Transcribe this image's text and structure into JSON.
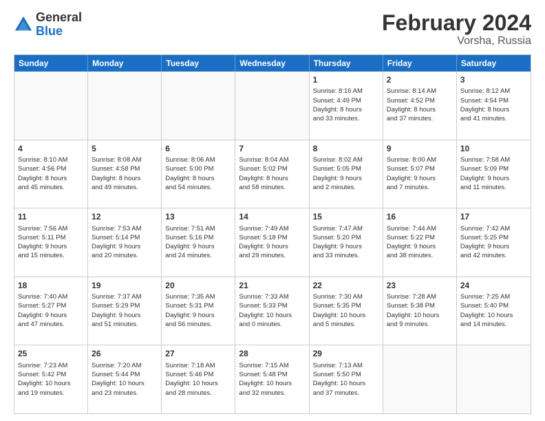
{
  "header": {
    "logo_general": "General",
    "logo_blue": "Blue",
    "month_title": "February 2024",
    "location": "Vorsha, Russia"
  },
  "days_of_week": [
    "Sunday",
    "Monday",
    "Tuesday",
    "Wednesday",
    "Thursday",
    "Friday",
    "Saturday"
  ],
  "rows": [
    [
      {
        "day": "",
        "info": ""
      },
      {
        "day": "",
        "info": ""
      },
      {
        "day": "",
        "info": ""
      },
      {
        "day": "",
        "info": ""
      },
      {
        "day": "1",
        "info": "Sunrise: 8:16 AM\nSunset: 4:49 PM\nDaylight: 8 hours\nand 33 minutes."
      },
      {
        "day": "2",
        "info": "Sunrise: 8:14 AM\nSunset: 4:52 PM\nDaylight: 8 hours\nand 37 minutes."
      },
      {
        "day": "3",
        "info": "Sunrise: 8:12 AM\nSunset: 4:54 PM\nDaylight: 8 hours\nand 41 minutes."
      }
    ],
    [
      {
        "day": "4",
        "info": "Sunrise: 8:10 AM\nSunset: 4:56 PM\nDaylight: 8 hours\nand 45 minutes."
      },
      {
        "day": "5",
        "info": "Sunrise: 8:08 AM\nSunset: 4:58 PM\nDaylight: 8 hours\nand 49 minutes."
      },
      {
        "day": "6",
        "info": "Sunrise: 8:06 AM\nSunset: 5:00 PM\nDaylight: 8 hours\nand 54 minutes."
      },
      {
        "day": "7",
        "info": "Sunrise: 8:04 AM\nSunset: 5:02 PM\nDaylight: 8 hours\nand 58 minutes."
      },
      {
        "day": "8",
        "info": "Sunrise: 8:02 AM\nSunset: 5:05 PM\nDaylight: 9 hours\nand 2 minutes."
      },
      {
        "day": "9",
        "info": "Sunrise: 8:00 AM\nSunset: 5:07 PM\nDaylight: 9 hours\nand 7 minutes."
      },
      {
        "day": "10",
        "info": "Sunrise: 7:58 AM\nSunset: 5:09 PM\nDaylight: 9 hours\nand 11 minutes."
      }
    ],
    [
      {
        "day": "11",
        "info": "Sunrise: 7:56 AM\nSunset: 5:11 PM\nDaylight: 9 hours\nand 15 minutes."
      },
      {
        "day": "12",
        "info": "Sunrise: 7:53 AM\nSunset: 5:14 PM\nDaylight: 9 hours\nand 20 minutes."
      },
      {
        "day": "13",
        "info": "Sunrise: 7:51 AM\nSunset: 5:16 PM\nDaylight: 9 hours\nand 24 minutes."
      },
      {
        "day": "14",
        "info": "Sunrise: 7:49 AM\nSunset: 5:18 PM\nDaylight: 9 hours\nand 29 minutes."
      },
      {
        "day": "15",
        "info": "Sunrise: 7:47 AM\nSunset: 5:20 PM\nDaylight: 9 hours\nand 33 minutes."
      },
      {
        "day": "16",
        "info": "Sunrise: 7:44 AM\nSunset: 5:22 PM\nDaylight: 9 hours\nand 38 minutes."
      },
      {
        "day": "17",
        "info": "Sunrise: 7:42 AM\nSunset: 5:25 PM\nDaylight: 9 hours\nand 42 minutes."
      }
    ],
    [
      {
        "day": "18",
        "info": "Sunrise: 7:40 AM\nSunset: 5:27 PM\nDaylight: 9 hours\nand 47 minutes."
      },
      {
        "day": "19",
        "info": "Sunrise: 7:37 AM\nSunset: 5:29 PM\nDaylight: 9 hours\nand 51 minutes."
      },
      {
        "day": "20",
        "info": "Sunrise: 7:35 AM\nSunset: 5:31 PM\nDaylight: 9 hours\nand 56 minutes."
      },
      {
        "day": "21",
        "info": "Sunrise: 7:33 AM\nSunset: 5:33 PM\nDaylight: 10 hours\nand 0 minutes."
      },
      {
        "day": "22",
        "info": "Sunrise: 7:30 AM\nSunset: 5:35 PM\nDaylight: 10 hours\nand 5 minutes."
      },
      {
        "day": "23",
        "info": "Sunrise: 7:28 AM\nSunset: 5:38 PM\nDaylight: 10 hours\nand 9 minutes."
      },
      {
        "day": "24",
        "info": "Sunrise: 7:25 AM\nSunset: 5:40 PM\nDaylight: 10 hours\nand 14 minutes."
      }
    ],
    [
      {
        "day": "25",
        "info": "Sunrise: 7:23 AM\nSunset: 5:42 PM\nDaylight: 10 hours\nand 19 minutes."
      },
      {
        "day": "26",
        "info": "Sunrise: 7:20 AM\nSunset: 5:44 PM\nDaylight: 10 hours\nand 23 minutes."
      },
      {
        "day": "27",
        "info": "Sunrise: 7:18 AM\nSunset: 5:46 PM\nDaylight: 10 hours\nand 28 minutes."
      },
      {
        "day": "28",
        "info": "Sunrise: 7:15 AM\nSunset: 5:48 PM\nDaylight: 10 hours\nand 32 minutes."
      },
      {
        "day": "29",
        "info": "Sunrise: 7:13 AM\nSunset: 5:50 PM\nDaylight: 10 hours\nand 37 minutes."
      },
      {
        "day": "",
        "info": ""
      },
      {
        "day": "",
        "info": ""
      }
    ]
  ]
}
